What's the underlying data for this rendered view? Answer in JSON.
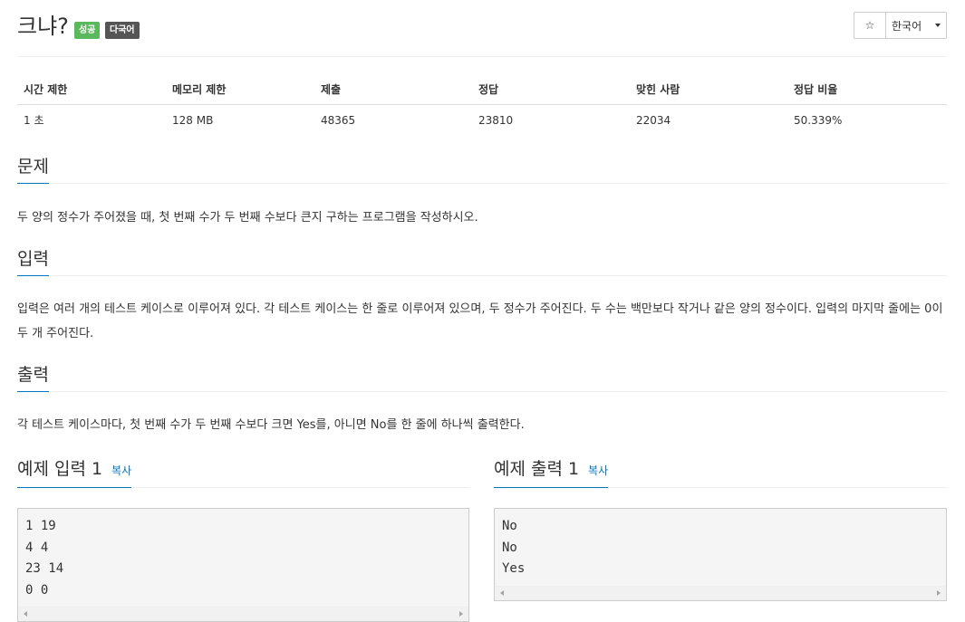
{
  "header": {
    "title": "크냐?",
    "badge_success": "성공",
    "badge_lang": "다국어",
    "star_icon": "☆",
    "language_select": "한국어"
  },
  "info": {
    "headers": [
      "시간 제한",
      "메모리 제한",
      "제출",
      "정답",
      "맞힌 사람",
      "정답 비율"
    ],
    "values": [
      "1 초",
      "128 MB",
      "48365",
      "23810",
      "22034",
      "50.339%"
    ]
  },
  "problem": {
    "heading": "문제",
    "text": "두 양의 정수가 주어졌을 때, 첫 번째 수가 두 번째 수보다 큰지 구하는 프로그램을 작성하시오."
  },
  "input": {
    "heading": "입력",
    "text": "입력은 여러 개의 테스트 케이스로 이루어져 있다. 각 테스트 케이스는 한 줄로 이루어져 있으며, 두 정수가 주어진다. 두 수는 백만보다 작거나 같은 양의 정수이다. 입력의 마지막 줄에는 0이 두 개 주어진다."
  },
  "output": {
    "heading": "출력",
    "text": "각 테스트 케이스마다, 첫 번째 수가 두 번째 수보다 크면 Yes를, 아니면 No를 한 줄에 하나씩 출력한다."
  },
  "sample_input": {
    "heading": "예제 입력 1",
    "copy": "복사",
    "content": "1 19\n4 4\n23 14\n0 0"
  },
  "sample_output": {
    "heading": "예제 출력 1",
    "copy": "복사",
    "content": "No\nNo\nYes"
  },
  "colors": {
    "accent": "#0076c0",
    "success": "#5cb85c",
    "lang_badge": "#555555"
  }
}
